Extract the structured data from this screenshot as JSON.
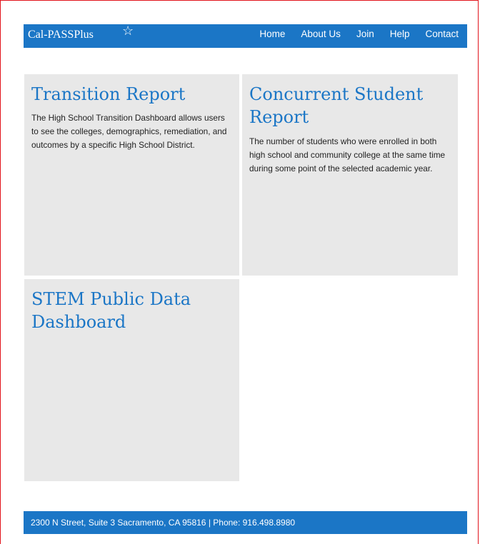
{
  "colors": {
    "brand_blue": "#1b76c6",
    "tile_gray": "#e8e8e8",
    "frame_red": "#e2131b"
  },
  "header": {
    "logo_text": "Cal-PASSPlus",
    "logo_icon": "star-icon",
    "nav": [
      {
        "label": "Home"
      },
      {
        "label": "About Us"
      },
      {
        "label": "Join"
      },
      {
        "label": "Help"
      },
      {
        "label": "Contact"
      }
    ]
  },
  "tiles": [
    {
      "title": "Transition Report",
      "description": "The High School Transition Dashboard allows users to see the colleges, demographics, remediation, and outcomes by a specific High School District."
    },
    {
      "title": "Concurrent Student Report",
      "description": "The number of students who were enrolled in both high school and community college at the same time during some point of the selected academic year."
    },
    {
      "title": "STEM Public Data Dashboard",
      "description": ""
    }
  ],
  "footer": {
    "text": "2300 N Street, Suite 3 Sacramento, CA 95816  |  Phone: 916.498.8980"
  }
}
